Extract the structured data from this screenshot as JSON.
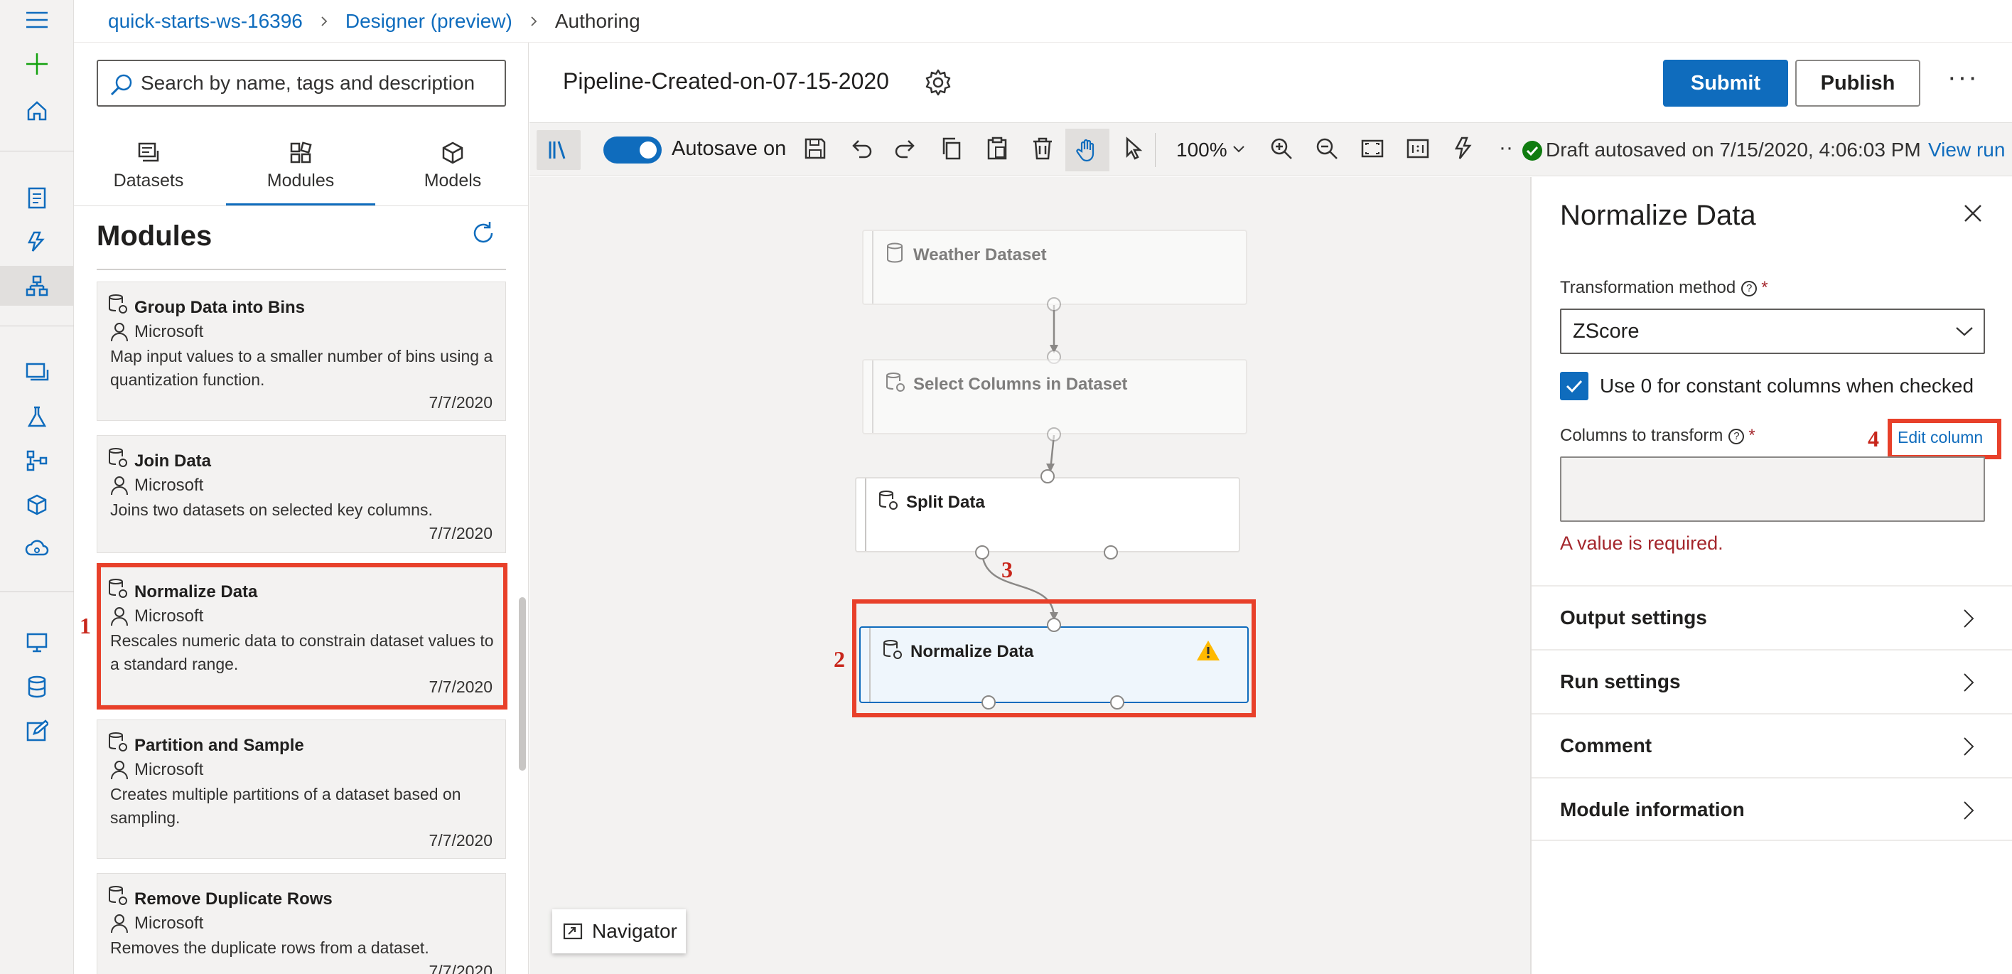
{
  "breadcrumb": {
    "workspace": "quick-starts-ws-16396",
    "designer": "Designer (preview)",
    "current": "Authoring"
  },
  "left_panel": {
    "search_placeholder": "Search by name, tags and description",
    "tabs": [
      {
        "label": "Datasets",
        "icon": "datasets-icon"
      },
      {
        "label": "Modules",
        "icon": "modules-icon",
        "active": true
      },
      {
        "label": "Models",
        "icon": "models-icon"
      }
    ],
    "section_title": "Modules",
    "modules": [
      {
        "name": "Group Data into Bins",
        "publisher": "Microsoft",
        "description": "Map input values to a smaller number of bins using a quantization function.",
        "date": "7/7/2020"
      },
      {
        "name": "Join Data",
        "publisher": "Microsoft",
        "description": "Joins two datasets on selected key columns.",
        "date": "7/7/2020"
      },
      {
        "name": "Normalize Data",
        "publisher": "Microsoft",
        "description": "Rescales numeric data to constrain dataset values to a standard range.",
        "date": "7/7/2020",
        "highlighted": true
      },
      {
        "name": "Partition and Sample",
        "publisher": "Microsoft",
        "description": "Creates multiple partitions of a dataset based on sampling.",
        "date": "7/7/2020"
      },
      {
        "name": "Remove Duplicate Rows",
        "publisher": "Microsoft",
        "description": "Removes the duplicate rows from a dataset.",
        "date": "7/7/2020"
      }
    ]
  },
  "header": {
    "pipeline_title": "Pipeline-Created-on-07-15-2020",
    "submit_label": "Submit",
    "publish_label": "Publish",
    "more_label": "···"
  },
  "toolbar": {
    "autosave_label": "Autosave on",
    "autosave_on": true,
    "zoom": "100%",
    "draft_status": "Draft autosaved on 7/15/2020, 4:06:03 PM",
    "view_run_label": "View run",
    "more_label": "··"
  },
  "canvas": {
    "nodes": [
      {
        "label": "Weather Dataset"
      },
      {
        "label": "Select Columns in Dataset"
      },
      {
        "label": "Split Data"
      },
      {
        "label": "Normalize Data",
        "warning": true,
        "selected": true
      }
    ],
    "navigator_label": "Navigator"
  },
  "annotations": {
    "n1": "1",
    "n2": "2",
    "n3": "3",
    "n4": "4"
  },
  "right_panel": {
    "title": "Normalize Data",
    "transformation_label": "Transformation method",
    "transformation_value": "ZScore",
    "checkbox_label": "Use 0 for constant columns when checked",
    "checkbox_checked": true,
    "columns_label": "Columns to transform",
    "edit_column_label": "Edit column",
    "required_msg": "A value is required.",
    "required_mark": "*",
    "help_mark": "?",
    "sections": [
      "Output settings",
      "Run settings",
      "Comment",
      "Module information"
    ]
  },
  "colors": {
    "accent": "#0f6cbd",
    "annotation": "#e8402a",
    "error": "#a4262c",
    "warning": "#ffb900",
    "success": "#107c10"
  }
}
